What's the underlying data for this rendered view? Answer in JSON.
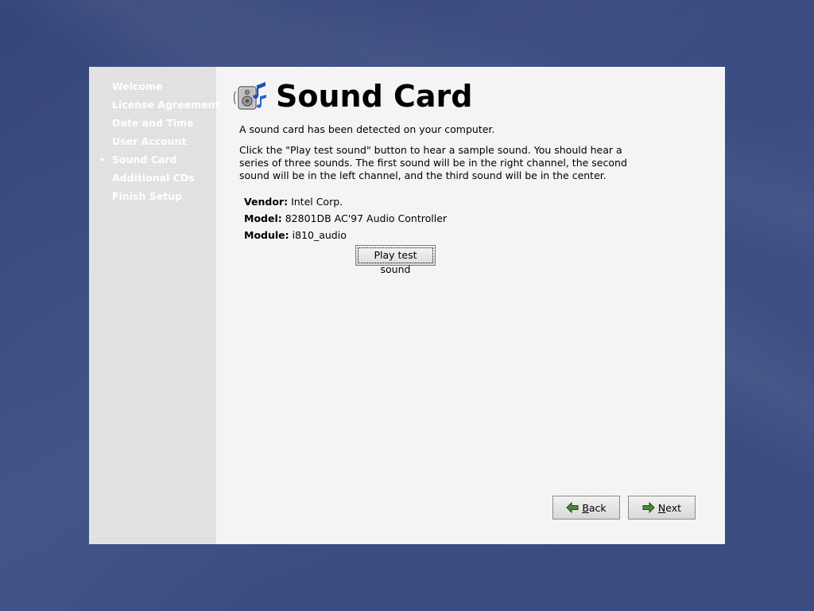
{
  "sidebar": {
    "items": [
      {
        "label": "Welcome",
        "active": false
      },
      {
        "label": "License Agreement",
        "active": false
      },
      {
        "label": "Date and Time",
        "active": false
      },
      {
        "label": "User Account",
        "active": false
      },
      {
        "label": "Sound Card",
        "active": true
      },
      {
        "label": "Additional CDs",
        "active": false
      },
      {
        "label": "Finish Setup",
        "active": false
      }
    ],
    "active_marker": "▸"
  },
  "header": {
    "title": "Sound Card",
    "icon": "sound-card-icon"
  },
  "main": {
    "intro": "A sound card has been detected on your computer.",
    "description": "Click the \"Play test sound\" button to hear a sample sound.  You should hear a series of three sounds.  The first sound will be in the right channel, the second sound will be in the left channel, and the third sound will be in the center.",
    "info": {
      "vendor_label": "Vendor:",
      "vendor_value": "Intel Corp.",
      "model_label": "Model:",
      "model_value": "82801DB AC'97 Audio Controller",
      "module_label": "Module:",
      "module_value": "i810_audio"
    },
    "play_button_label": "Play test sound"
  },
  "navigation": {
    "back": {
      "mnemonic": "B",
      "rest": "ack",
      "icon": "arrow-left-icon"
    },
    "next": {
      "mnemonic": "N",
      "rest": "ext",
      "icon": "arrow-right-icon"
    }
  },
  "colors": {
    "desktop": "#3a4a7a",
    "window_bg": "#f4f4f4",
    "sidebar_bg": "#dedede",
    "sidebar_text": "#ffffff",
    "arrow_icon": "#3c7a2c"
  }
}
